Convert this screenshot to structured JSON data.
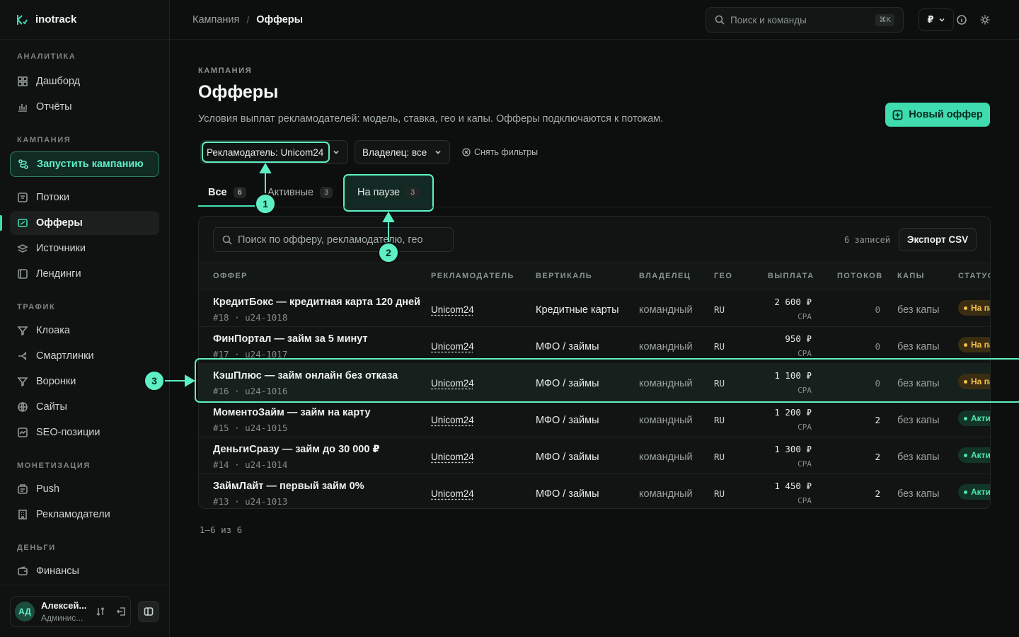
{
  "app": {
    "name": "inotrack"
  },
  "sidebar": {
    "sections": [
      {
        "title": "АНАЛИТИКА",
        "items": [
          "Дашборд",
          "Отчёты"
        ]
      },
      {
        "title": "КАМПАНИЯ",
        "launch": "Запустить кампанию",
        "items": [
          "Потоки",
          "Офферы",
          "Источники",
          "Лендинги"
        ]
      },
      {
        "title": "ТРАФИК",
        "items": [
          "Клоака",
          "Смартлинки",
          "Воронки",
          "Сайты",
          "SEO-позиции"
        ]
      },
      {
        "title": "МОНЕТИЗАЦИЯ",
        "items": [
          "Push",
          "Рекламодатели"
        ]
      },
      {
        "title": "ДЕНЬГИ",
        "items": [
          "Финансы"
        ]
      }
    ],
    "user": {
      "initials": "АД",
      "name": "Алексей...",
      "role": "Админис..."
    }
  },
  "topbar": {
    "breadcrumb": [
      "Кампания",
      "Офферы"
    ],
    "search_placeholder": "Поиск и команды",
    "shortcut": "⌘K",
    "currency": "₽"
  },
  "page": {
    "eyebrow": "КАМПАНИЯ",
    "title": "Офферы",
    "subtitle": "Условия выплат рекламодателей: модель, ставка, гео и капы. Офферы подключаются к потокам.",
    "new_button": "Новый оффер"
  },
  "filters": {
    "advertiser": "Рекламодатель: Unicom24",
    "owner": "Владелец: все",
    "clear": "Снять фильтры"
  },
  "tabs": [
    {
      "label": "Все",
      "count": "6"
    },
    {
      "label": "Активные",
      "count": "3"
    },
    {
      "label": "На паузе",
      "count": "3"
    }
  ],
  "table": {
    "search_placeholder": "Поиск по офферу, рекламодателю, гео",
    "records": "6 записей",
    "export": "Экспорт CSV",
    "columns": [
      "ОФФЕР",
      "РЕКЛАМОДАТЕЛЬ",
      "ВЕРТИКАЛЬ",
      "ВЛАДЕЛЕЦ",
      "ГЕО",
      "ВЫПЛАТА",
      "ПОТОКОВ",
      "КАПЫ",
      "СТАТУС"
    ],
    "rows": [
      {
        "name": "КредитБокс — кредитная карта 120 дней",
        "meta": "#18 · u24-1018",
        "advertiser": "Unicom24",
        "vertical": "Кредитные карты",
        "owner": "командный",
        "geo": "RU",
        "payout": "2 600 ₽",
        "model": "CPA",
        "flows": "0",
        "caps": "без капы",
        "status": "На паузе"
      },
      {
        "name": "ФинПортал — займ за 5 минут",
        "meta": "#17 · u24-1017",
        "advertiser": "Unicom24",
        "vertical": "МФО / займы",
        "owner": "командный",
        "geo": "RU",
        "payout": "950 ₽",
        "model": "CPA",
        "flows": "0",
        "caps": "без капы",
        "status": "На паузе"
      },
      {
        "name": "КэшПлюс — займ онлайн без отказа",
        "meta": "#16 · u24-1016",
        "advertiser": "Unicom24",
        "vertical": "МФО / займы",
        "owner": "командный",
        "geo": "RU",
        "payout": "1 100 ₽",
        "model": "CPA",
        "flows": "0",
        "caps": "без капы",
        "status": "На паузе"
      },
      {
        "name": "МоментоЗайм — займ на карту",
        "meta": "#15 · u24-1015",
        "advertiser": "Unicom24",
        "vertical": "МФО / займы",
        "owner": "командный",
        "geo": "RU",
        "payout": "1 200 ₽",
        "model": "CPA",
        "flows": "2",
        "caps": "без капы",
        "status": "Активен"
      },
      {
        "name": "ДеньгиСразу — займ до 30 000 ₽",
        "meta": "#14 · u24-1014",
        "advertiser": "Unicom24",
        "vertical": "МФО / займы",
        "owner": "командный",
        "geo": "RU",
        "payout": "1 300 ₽",
        "model": "CPA",
        "flows": "2",
        "caps": "без капы",
        "status": "Активен"
      },
      {
        "name": "ЗаймЛайт — первый займ 0%",
        "meta": "#13 · u24-1013",
        "advertiser": "Unicom24",
        "vertical": "МФО / займы",
        "owner": "командный",
        "geo": "RU",
        "payout": "1 450 ₽",
        "model": "CPA",
        "flows": "2",
        "caps": "без капы",
        "status": "Активен"
      },
      null
    ],
    "pager": "1–6 из 6"
  },
  "annotations": [
    "1",
    "2",
    "3"
  ],
  "colors": {
    "accent": "#3fdcb0",
    "highlight": "#5ef0c4",
    "pause": "#f2c04e",
    "active": "#4fe3a7",
    "bg": "#0d0f0e"
  }
}
